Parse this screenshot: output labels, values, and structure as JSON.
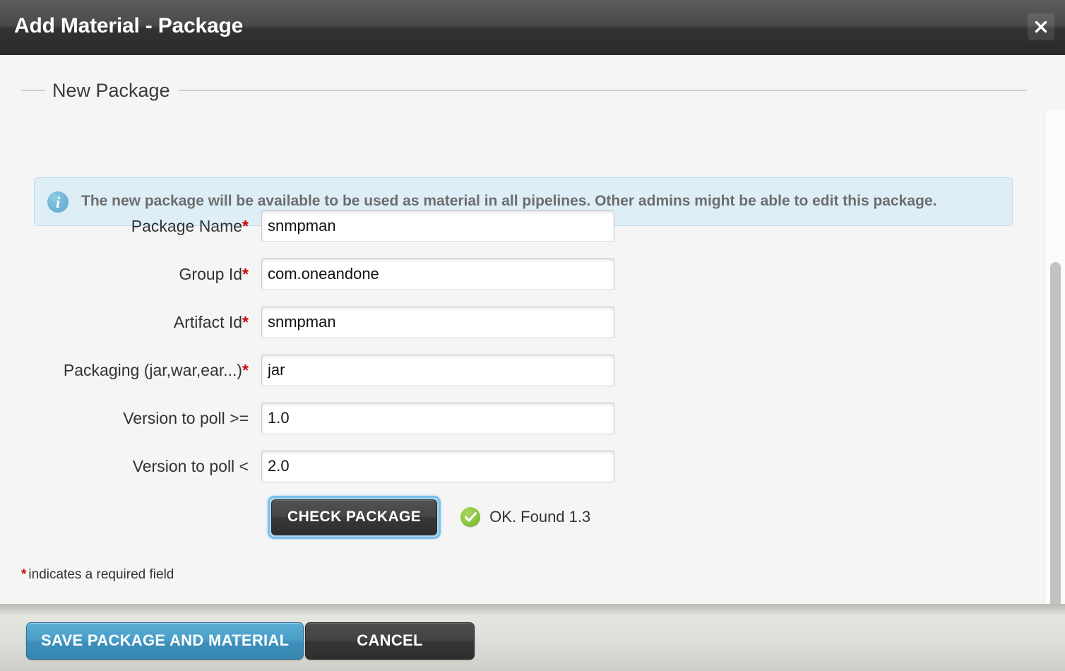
{
  "header": {
    "title": "Add Material - Package",
    "close_icon": "close-icon"
  },
  "fieldset": {
    "legend": "New Package"
  },
  "info": {
    "icon": "info-icon",
    "message": "The new package will be available to be used as material in all pipelines. Other admins might be able to edit this package."
  },
  "form": {
    "fields": [
      {
        "label": "Package Name",
        "required": true,
        "value": "snmpman",
        "name": "package-name"
      },
      {
        "label": "Group Id",
        "required": true,
        "value": "com.oneandone",
        "name": "group-id"
      },
      {
        "label": "Artifact Id",
        "required": true,
        "value": "snmpman",
        "name": "artifact-id"
      },
      {
        "label": "Packaging (jar,war,ear...)",
        "required": true,
        "value": "jar",
        "name": "packaging"
      },
      {
        "label": "Version to poll >=",
        "required": false,
        "value": "1.0",
        "name": "version-poll-gte"
      },
      {
        "label": "Version to poll <",
        "required": false,
        "value": "2.0",
        "name": "version-poll-lt"
      }
    ],
    "required_marker": "*",
    "required_note": "indicates a required field"
  },
  "check": {
    "button_label": "CHECK PACKAGE",
    "status_icon": "check-circle-icon",
    "status_text": "OK. Found 1.3"
  },
  "footer": {
    "save_label": "SAVE PACKAGE AND MATERIAL",
    "cancel_label": "CANCEL"
  },
  "colors": {
    "accent_blue": "#3d8fba",
    "focus_ring": "#7cc0ee",
    "required_red": "#cc0000",
    "info_bg": "#ddeef7",
    "success_green": "#8cc63f",
    "header_dark": "#2a2a2a"
  }
}
